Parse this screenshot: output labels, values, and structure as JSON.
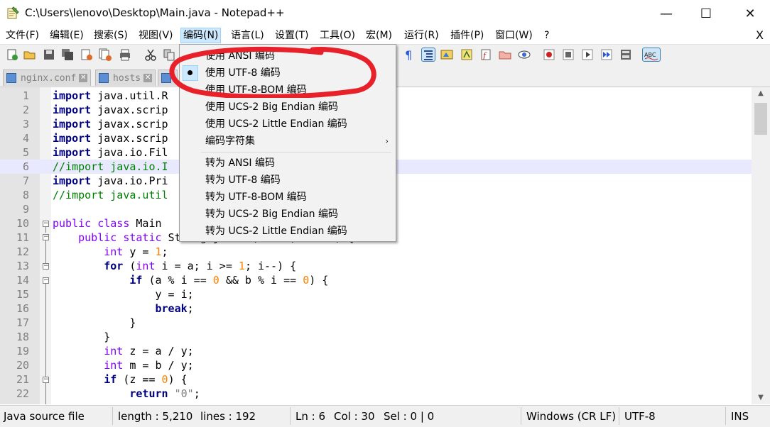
{
  "window": {
    "title": "C:\\Users\\lenovo\\Desktop\\Main.java - Notepad++",
    "minimize": "—",
    "maximize": "☐",
    "close": "✕"
  },
  "menubar": {
    "items": [
      "文件(F)",
      "编辑(E)",
      "搜索(S)",
      "视图(V)",
      "编码(N)",
      "语言(L)",
      "设置(T)",
      "工具(O)",
      "宏(M)",
      "运行(R)",
      "插件(P)",
      "窗口(W)",
      "?"
    ],
    "close": "X"
  },
  "tabs": [
    {
      "label": "nginx.conf"
    },
    {
      "label": "hosts"
    }
  ],
  "code_lines": [
    {
      "n": "1",
      "html": "<span class='kw'>import</span> java.util.R"
    },
    {
      "n": "2",
      "html": "<span class='kw'>import</span> javax.scrip"
    },
    {
      "n": "3",
      "html": "<span class='kw'>import</span> javax.scrip"
    },
    {
      "n": "4",
      "html": "<span class='kw'>import</span> javax.scrip"
    },
    {
      "n": "5",
      "html": "<span class='kw'>import</span> java.io.Fil"
    },
    {
      "n": "6",
      "html": "<span class='cmt'>//import java.io.I</span>"
    },
    {
      "n": "7",
      "html": "<span class='kw'>import</span> java.io.Pri"
    },
    {
      "n": "8",
      "html": "<span class='cmt'>//import java.util</span>"
    },
    {
      "n": "9",
      "html": ""
    },
    {
      "n": "10",
      "html": "<span class='type'>public</span> <span class='type'>class</span> Main"
    },
    {
      "n": "11",
      "html": "    <span class='type'>public</span> <span class='type'>static</span> String jactor(<span class='type'>int</span> a, <span class='type'>int</span> b) {"
    },
    {
      "n": "12",
      "html": "        <span class='type'>int</span> y = <span class='num'>1</span>;"
    },
    {
      "n": "13",
      "html": "        <span class='kw'>for</span> (<span class='type'>int</span> i = a; i &gt;= <span class='num'>1</span>; i--) {"
    },
    {
      "n": "14",
      "html": "            <span class='kw'>if</span> (a % i == <span class='num'>0</span> &amp;&amp; b % i == <span class='num'>0</span>) {"
    },
    {
      "n": "15",
      "html": "                y = i;"
    },
    {
      "n": "16",
      "html": "                <span class='kw'>break</span>;"
    },
    {
      "n": "17",
      "html": "            }"
    },
    {
      "n": "18",
      "html": "        }"
    },
    {
      "n": "19",
      "html": "        <span class='type'>int</span> z = a / y;"
    },
    {
      "n": "20",
      "html": "        <span class='type'>int</span> m = b / y;"
    },
    {
      "n": "21",
      "html": "        <span class='kw'>if</span> (z == <span class='num'>0</span>) {"
    },
    {
      "n": "22",
      "html": "            <span class='kw'>return</span> <span class='str'>\"0\"</span>;"
    }
  ],
  "encoding_menu": {
    "items": [
      {
        "label": "使用 ANSI 编码",
        "checked": false
      },
      {
        "label": "使用 UTF-8 编码",
        "checked": true
      },
      {
        "label": "使用 UTF-8-BOM 编码",
        "checked": false
      },
      {
        "label": "使用 UCS-2 Big Endian 编码",
        "checked": false
      },
      {
        "label": "使用 UCS-2 Little Endian 编码",
        "checked": false
      },
      {
        "label": "编码字符集",
        "submenu": true
      }
    ],
    "convert_items": [
      "转为 ANSI 编码",
      "转为 UTF-8 编码",
      "转为 UTF-8-BOM 编码",
      "转为 UCS-2 Big Endian 编码",
      "转为 UCS-2 Little Endian 编码"
    ]
  },
  "statusbar": {
    "file_type": "Java source file",
    "length": "length : 5,210",
    "lines": "lines : 192",
    "ln": "Ln : 6",
    "col": "Col : 30",
    "sel": "Sel : 0 | 0",
    "eol": "Windows (CR LF)",
    "encoding": "UTF-8",
    "mode": "INS"
  },
  "colors": {
    "accent": "#cce8ff",
    "keyword": "#00007f",
    "type": "#8000ff",
    "number": "#ff8000",
    "comment": "#008000",
    "annotation": "#e8202a"
  }
}
